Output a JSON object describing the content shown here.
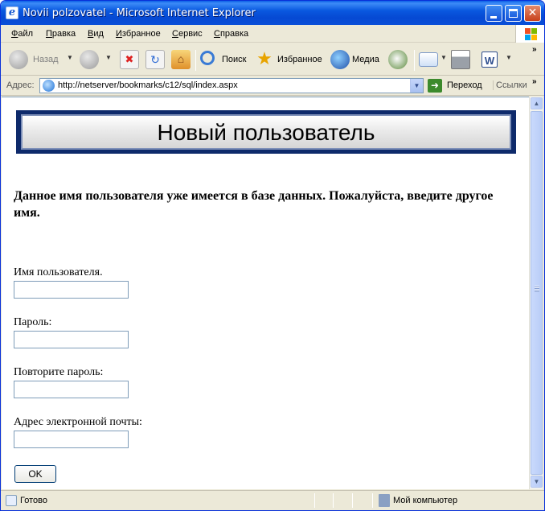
{
  "window": {
    "title": "Novii polzovatel - Microsoft Internet Explorer"
  },
  "menu": {
    "items": [
      "Файл",
      "Правка",
      "Вид",
      "Избранное",
      "Сервис",
      "Справка"
    ]
  },
  "toolbar": {
    "back_label": "Назад",
    "search_label": "Поиск",
    "favorites_label": "Избранное",
    "media_label": "Медиа"
  },
  "address": {
    "label": "Адрес:",
    "url": "http://netserver/bookmarks/c12/sql/index.aspx",
    "go_label": "Переход",
    "links_label": "Ссылки"
  },
  "page": {
    "banner_title": "Новый пользователь",
    "error_message": "Данное имя пользователя уже имеется в базе данных. Пожалуйста, введите другое имя.",
    "fields": {
      "username_label": "Имя пользователя.",
      "username_value": "",
      "password_label": "Пароль:",
      "password_value": "",
      "repeat_password_label": "Повторите пароль:",
      "repeat_password_value": "",
      "email_label": "Адрес электронной почты:",
      "email_value": ""
    },
    "ok_label": "OK"
  },
  "status": {
    "text": "Готово",
    "zone": "Мой компьютер"
  },
  "colors": {
    "titlebar": "#0a59e0",
    "chrome": "#ece9d8",
    "banner_border": "#0e2a6b",
    "input_border": "#7f9db9"
  }
}
